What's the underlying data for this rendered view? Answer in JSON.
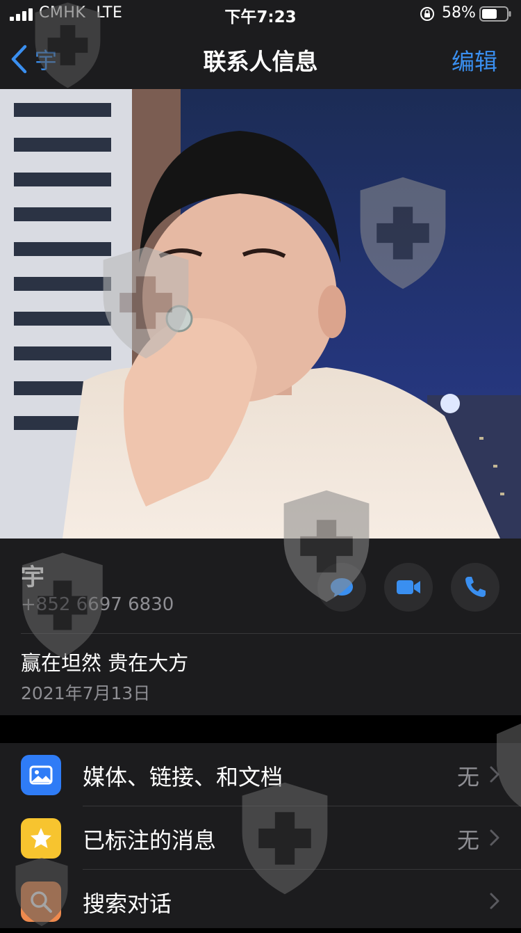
{
  "status_bar": {
    "carrier": "CMHK",
    "network": "LTE",
    "time": "下午7:23",
    "battery": "58%"
  },
  "nav": {
    "back_label": "宇",
    "title": "联系人信息",
    "edit_label": "编辑"
  },
  "contact": {
    "name": "宇",
    "phone": "+852 6697 6830",
    "about": "赢在坦然 贵在大方",
    "about_date": "2021年7月13日",
    "actions": [
      "message-icon",
      "video-icon",
      "phone-icon"
    ]
  },
  "list": {
    "items": [
      {
        "icon": "media-icon",
        "label": "媒体、链接、和文档",
        "value": "无",
        "color": "#2f7cf6"
      },
      {
        "icon": "star-icon",
        "label": "已标注的消息",
        "value": "无",
        "color": "#f7c42f"
      },
      {
        "icon": "search-icon",
        "label": "搜索对话",
        "value": "",
        "color": "#ee8a4e"
      }
    ]
  },
  "colors": {
    "accent": "#3a8ff0",
    "background": "#000000",
    "cell": "#1c1c1e",
    "secondary_text": "#8e8e93"
  }
}
